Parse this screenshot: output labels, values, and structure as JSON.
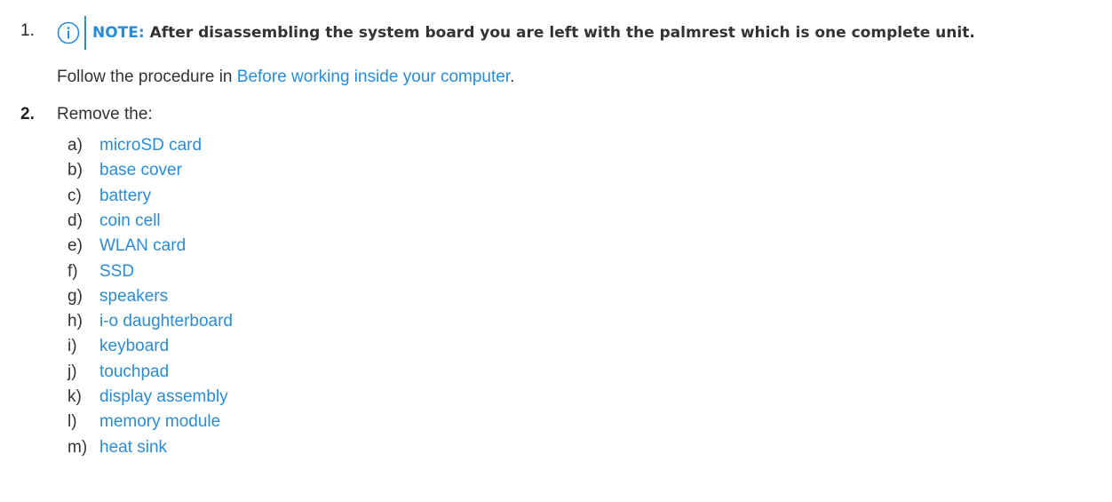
{
  "steps": {
    "step1": {
      "number": "1.",
      "note_label": "NOTE:",
      "note_text": "After disassembling the system board you are left with the palmrest which is one complete unit.",
      "follow_prefix": "Follow the procedure in ",
      "follow_link": "Before working inside your computer",
      "follow_suffix": "."
    },
    "step2": {
      "number": "2.",
      "text": "Remove the:",
      "items": [
        {
          "letter": "a)",
          "label": "microSD card"
        },
        {
          "letter": "b)",
          "label": "base cover"
        },
        {
          "letter": "c)",
          "label": "battery"
        },
        {
          "letter": "d)",
          "label": "coin cell"
        },
        {
          "letter": "e)",
          "label": "WLAN card"
        },
        {
          "letter": "f)",
          "label": "SSD"
        },
        {
          "letter": "g)",
          "label": "speakers"
        },
        {
          "letter": "h)",
          "label": "i-o daughterboard"
        },
        {
          "letter": "i)",
          "label": "keyboard"
        },
        {
          "letter": "j)",
          "label": "touchpad"
        },
        {
          "letter": "k)",
          "label": "display assembly"
        },
        {
          "letter": "l)",
          "label": "memory module"
        },
        {
          "letter": "m)",
          "label": "heat sink"
        }
      ]
    }
  },
  "colors": {
    "accent": "#2a8bd6",
    "text": "#333333"
  },
  "icons": {
    "note": "info-circle-icon"
  }
}
